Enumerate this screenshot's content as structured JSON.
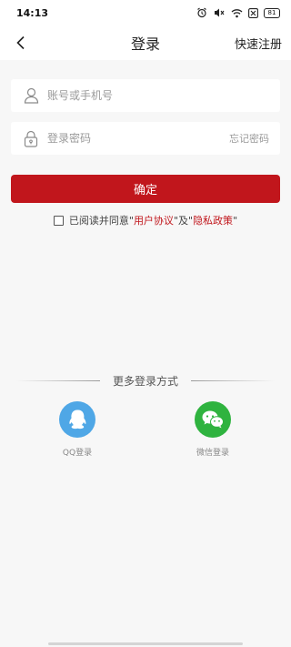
{
  "status_bar": {
    "time": "14:13",
    "battery": "81",
    "icons": [
      "alarm-icon",
      "mute-icon",
      "wifi-icon",
      "sim-off-icon",
      "battery-icon"
    ]
  },
  "nav": {
    "title": "登录",
    "right_action": "快速注册",
    "back_icon": "chevron-left-icon"
  },
  "form": {
    "account_placeholder": "账号或手机号",
    "account_value": "",
    "password_placeholder": "登录密码",
    "password_value": "",
    "forgot_label": "忘记密码",
    "confirm_label": "确定"
  },
  "agreement": {
    "checked": false,
    "prefix": "已阅读并同意",
    "open_quote_1": "\"",
    "user_agreement": "用户协议",
    "close_quote_1": "\"",
    "joiner": "及",
    "open_quote_2": "\"",
    "privacy_policy": "隐私政策",
    "close_quote_2": "\""
  },
  "more_login": {
    "title": "更多登录方式",
    "options": [
      {
        "label": "QQ登录",
        "icon": "qq-icon",
        "color": "#4fa7e6"
      },
      {
        "label": "微信登录",
        "icon": "wechat-icon",
        "color": "#2fb33f"
      }
    ]
  },
  "colors": {
    "accent": "#c1161c",
    "background": "#f7f7f7",
    "placeholder": "#9a9a9a"
  }
}
